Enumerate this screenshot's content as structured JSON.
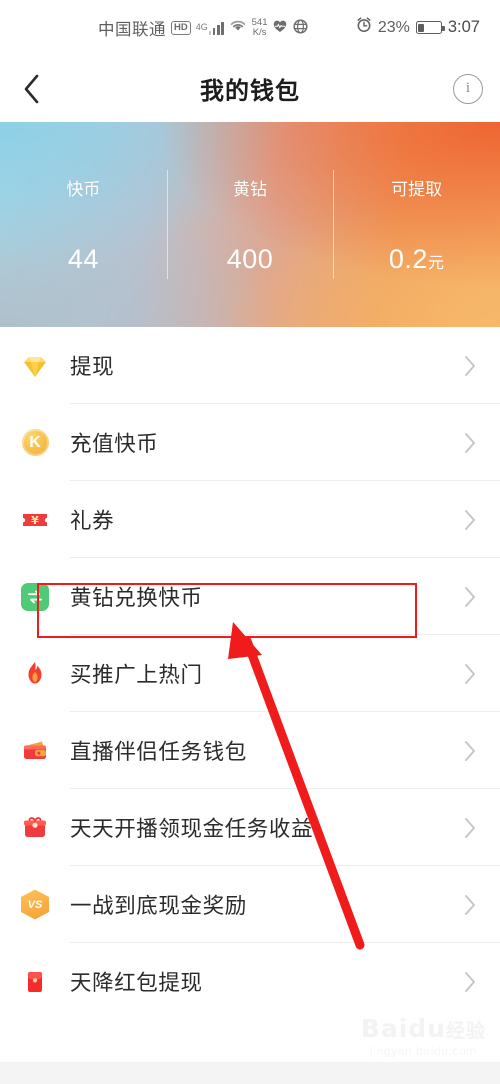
{
  "statusbar": {
    "carrier": "中国联通",
    "hd_badge": "HD",
    "network_type": "4G",
    "speed_value": "541",
    "speed_unit": "K/s",
    "battery_percent": "23%",
    "clock": "3:07",
    "icons": [
      "hd-icon",
      "signal-bars-icon",
      "wifi-icon",
      "heart-icon",
      "globe-icon",
      "alarm-clock-icon",
      "battery-icon"
    ]
  },
  "header": {
    "title": "我的钱包",
    "back_icon": "chevron-left-icon",
    "info_icon": "info-circle-icon"
  },
  "banner": {
    "stats": [
      {
        "label": "快币",
        "value": "44",
        "unit": ""
      },
      {
        "label": "黄钻",
        "value": "400",
        "unit": ""
      },
      {
        "label": "可提取",
        "value": "0.2",
        "unit": "元"
      }
    ],
    "gradient_from": "#a9d6e6",
    "gradient_to": "#f0a35f"
  },
  "list": {
    "items": [
      {
        "label": "提现",
        "icon": "diamond-icon",
        "chevron": "chevron-right-icon"
      },
      {
        "label": "充值快币",
        "icon": "k-coin-icon",
        "chevron": "chevron-right-icon"
      },
      {
        "label": "礼券",
        "icon": "coupon-icon",
        "chevron": "chevron-right-icon"
      },
      {
        "label": "黄钻兑换快币",
        "icon": "exchange-icon",
        "chevron": "chevron-right-icon"
      },
      {
        "label": "买推广上热门",
        "icon": "flame-icon",
        "chevron": "chevron-right-icon"
      },
      {
        "label": "直播伴侣任务钱包",
        "icon": "wallet-icon",
        "chevron": "chevron-right-icon"
      },
      {
        "label": "天天开播领现金任务收益",
        "icon": "gift-box-icon",
        "chevron": "chevron-right-icon"
      },
      {
        "label": "一战到底现金奖励",
        "icon": "vs-hexagon-icon",
        "chevron": "chevron-right-icon"
      },
      {
        "label": "天降红包提现",
        "icon": "red-packet-icon",
        "chevron": "chevron-right-icon"
      }
    ]
  },
  "annotations": {
    "highlight_color": "#f01c1c",
    "highlight_target": "黄钻兑换快币",
    "arrow_color": "#f01c1c"
  },
  "watermark": {
    "brand": "Baidu",
    "brand_cn": "经验",
    "url": "jingyan.baidu.com"
  }
}
